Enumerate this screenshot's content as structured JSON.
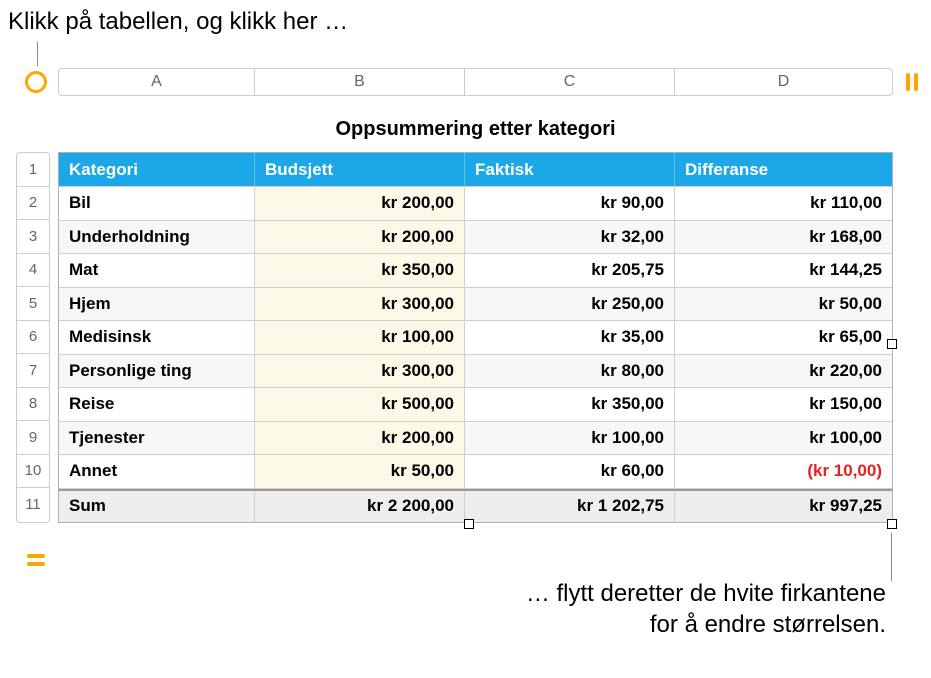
{
  "annotations": {
    "top": "Klikk på tabellen, og klikk her …",
    "bottom_line1": "… flytt deretter de hvite firkantene",
    "bottom_line2": "for å endre størrelsen."
  },
  "columns": [
    "A",
    "B",
    "C",
    "D"
  ],
  "row_numbers": [
    "1",
    "2",
    "3",
    "4",
    "5",
    "6",
    "7",
    "8",
    "9",
    "10",
    "11"
  ],
  "table": {
    "title": "Oppsummering etter kategori",
    "headers": {
      "category": "Kategori",
      "budget": "Budsjett",
      "actual": "Faktisk",
      "difference": "Differanse"
    },
    "rows": [
      {
        "category": "Bil",
        "budget": "kr 200,00",
        "actual": "kr 90,00",
        "difference": "kr 110,00",
        "negative": false
      },
      {
        "category": "Underholdning",
        "budget": "kr 200,00",
        "actual": "kr 32,00",
        "difference": "kr 168,00",
        "negative": false
      },
      {
        "category": "Mat",
        "budget": "kr 350,00",
        "actual": "kr 205,75",
        "difference": "kr 144,25",
        "negative": false
      },
      {
        "category": "Hjem",
        "budget": "kr 300,00",
        "actual": "kr 250,00",
        "difference": "kr 50,00",
        "negative": false
      },
      {
        "category": "Medisinsk",
        "budget": "kr 100,00",
        "actual": "kr 35,00",
        "difference": "kr 65,00",
        "negative": false
      },
      {
        "category": "Personlige ting",
        "budget": "kr 300,00",
        "actual": "kr 80,00",
        "difference": "kr 220,00",
        "negative": false
      },
      {
        "category": "Reise",
        "budget": "kr 500,00",
        "actual": "kr 350,00",
        "difference": "kr 150,00",
        "negative": false
      },
      {
        "category": "Tjenester",
        "budget": "kr 200,00",
        "actual": "kr 100,00",
        "difference": "kr 100,00",
        "negative": false
      },
      {
        "category": "Annet",
        "budget": "kr 50,00",
        "actual": "kr 60,00",
        "difference": "(kr 10,00)",
        "negative": true
      }
    ],
    "sum": {
      "label": "Sum",
      "budget": "kr 2 200,00",
      "actual": "kr 1 202,75",
      "difference": "kr 997,25"
    }
  }
}
